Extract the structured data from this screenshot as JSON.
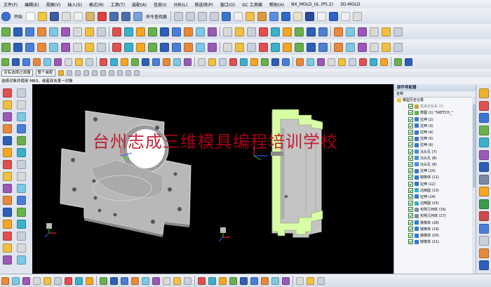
{
  "menu": [
    "文件(F)",
    "编辑(E)",
    "视图(V)",
    "插入(S)",
    "格式(R)",
    "工具(T)",
    "装配(A)",
    "信息(I)",
    "分析(L)",
    "首选项(P)",
    "窗口(O)",
    "GC 工具箱",
    "帮助(H)",
    "NX_MOLD_UL (P5.2)",
    "3D-MOLD"
  ],
  "toolbar1": {
    "start_label": "开始",
    "command_finder_label": "命令查找器"
  },
  "selection": {
    "filter_value": "没有选择过滤器",
    "scope_value": "整个装配"
  },
  "cue_line": "选择对象并使用 MB3，或者双击某一对象",
  "watermark": "台州志成三维模具编程培训学校",
  "navigator": {
    "title": "部件导航器",
    "col_name": "名称",
    "items": [
      {
        "label": "模型历史记录",
        "kind": "folder"
      },
      {
        "label": "基准坐标系 (0)",
        "kind": "datum"
      },
      {
        "label": "草图 (1) \"SKETCH_\"",
        "kind": "sketch"
      },
      {
        "label": "拉伸 (2)",
        "kind": "extrude"
      },
      {
        "label": "拉伸 (3)",
        "kind": "extrude"
      },
      {
        "label": "拉伸 (4)",
        "kind": "extrude"
      },
      {
        "label": "拉伸 (5)",
        "kind": "extrude"
      },
      {
        "label": "拉伸 (6)",
        "kind": "extrude"
      },
      {
        "label": "沉头孔 (7)",
        "kind": "hole"
      },
      {
        "label": "沉头孔 (8)",
        "kind": "hole"
      },
      {
        "label": "沉头孔 (9)",
        "kind": "hole"
      },
      {
        "label": "拉伸 (10)",
        "kind": "extrude"
      },
      {
        "label": "镜像体 (11)",
        "kind": "mirror"
      },
      {
        "label": "拉伸 (12)",
        "kind": "extrude"
      },
      {
        "label": "边倒圆 (13)",
        "kind": "blend"
      },
      {
        "label": "拉伸 (14)",
        "kind": "extrude"
      },
      {
        "label": "边倒圆 (15)",
        "kind": "blend"
      },
      {
        "label": "实例几何体 (16)",
        "kind": "instance"
      },
      {
        "label": "实例几何体 (17)",
        "kind": "instance"
      },
      {
        "label": "镜像体 (18)",
        "kind": "mirror"
      },
      {
        "label": "镜像体 (19)",
        "kind": "mirror"
      },
      {
        "label": "镜像体 (20)",
        "kind": "mirror"
      },
      {
        "label": "镜像体 (21)",
        "kind": "mirror"
      }
    ]
  },
  "colors": {
    "viewport_bg": "#000000",
    "section_cut": "#d9ffa6",
    "part_gray": "#bfbfbf",
    "watermark": "#c0001a"
  }
}
